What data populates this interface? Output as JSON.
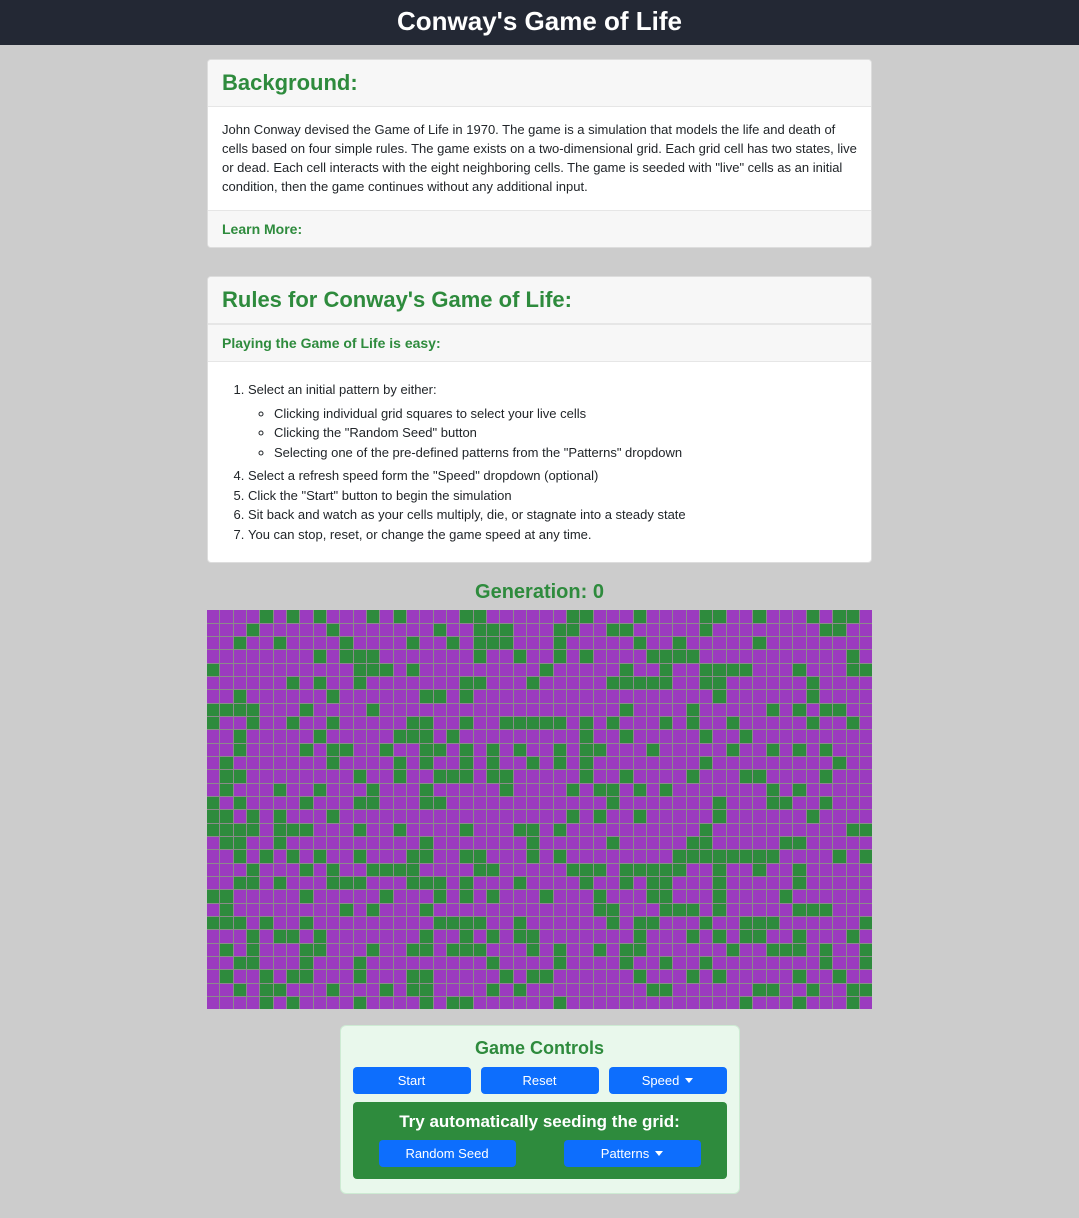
{
  "header": {
    "title": "Conway's Game of Life"
  },
  "background": {
    "title": "Background:",
    "body": "John Conway devised the Game of Life in 1970. The game is a simulation that models the life and death of cells based on four simple rules. The game exists on a two-dimensional grid. Each grid cell has two states, live or dead. Each cell interacts with the eight neighboring cells. The game is seeded with \"live\" cells as an initial condition, then the game continues without any additional input.",
    "learn_more": "Learn More:"
  },
  "rules": {
    "title": "Rules for Conway's Game of Life:",
    "subtitle": "Playing the Game of Life is easy:",
    "step1": "Select an initial pattern by either:",
    "step1_sub": [
      "Clicking individual grid squares to select your live cells",
      "Clicking the \"Random Seed\" button",
      "Selecting one of the pre-defined patterns from the \"Patterns\" dropdown"
    ],
    "step4": "Select a refresh speed form the \"Speed\" dropdown (optional)",
    "step5": "Click the \"Start\" button to begin the simulation",
    "step6": "Sit back and watch as your cells multiply, die, or stagnate into a steady state",
    "step7": "You can stop, reset, or change the game speed at any time."
  },
  "generation": {
    "label": "Generation: ",
    "value": "0"
  },
  "grid": {
    "rows": 30,
    "cols": 50,
    "fill_probability": 0.3
  },
  "controls": {
    "title": "Game Controls",
    "start": "Start",
    "reset": "Reset",
    "speed": "Speed",
    "seed_title": "Try automatically seeding the grid:",
    "random_seed": "Random Seed",
    "patterns": "Patterns"
  }
}
